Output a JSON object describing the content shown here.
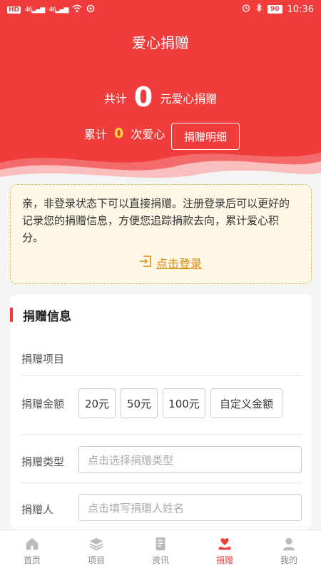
{
  "status_bar": {
    "carrier_badge": "HD",
    "signal1": "46",
    "signal2": "46",
    "battery": "90",
    "time": "10:36"
  },
  "header": {
    "title": "爱心捐赠",
    "total_prefix": "共计",
    "total_amount": "0",
    "total_suffix": "元爱心捐赠",
    "count_prefix": "累计",
    "count_value": "0",
    "count_suffix": "次爱心",
    "detail_button": "捐赠明细"
  },
  "notice": {
    "text": "亲，非登录状态下可以直接捐赠。注册登录后可以更好的记录您的捐赠信息，方便您追踪捐款去向，累计爱心积分。",
    "login_link": "点击登录"
  },
  "form": {
    "section_title": "捐赠信息",
    "project_label": "捐赠项目",
    "amount_label": "捐赠金额",
    "amount_options": [
      "20元",
      "50元",
      "100元",
      "自定义金额"
    ],
    "type_label": "捐赠类型",
    "type_placeholder": "点击选择捐赠类型",
    "donor_label": "捐赠人",
    "donor_placeholder": "点击填写捐赠人姓名"
  },
  "tabbar": {
    "items": [
      "首页",
      "项目",
      "资讯",
      "捐赠",
      "我的"
    ],
    "active": "捐赠"
  },
  "colors": {
    "primary": "#f13c3c",
    "highlight": "#ffd93a",
    "link": "#e08a10"
  }
}
